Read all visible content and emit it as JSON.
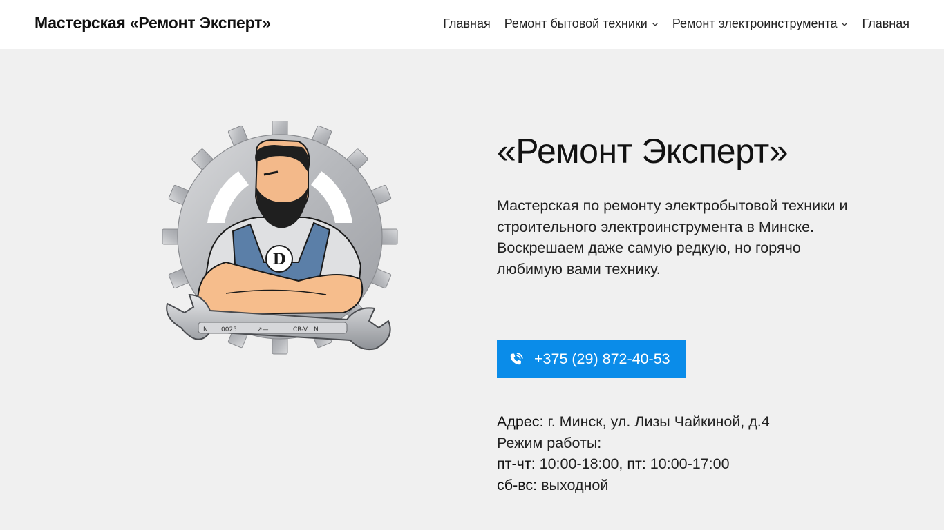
{
  "header": {
    "site_title": "Мастерская «Ремонт Эксперт»",
    "nav": [
      {
        "label": "Главная"
      },
      {
        "label": "Ремонт бытовой техники",
        "dropdown": true
      },
      {
        "label": "Ремонт электроинструмента",
        "dropdown": true
      },
      {
        "label": "Главная"
      }
    ]
  },
  "hero": {
    "title": "«Ремонт Эксперт»",
    "description": "Мастерская по ремонту электробытовой техники и строительного электроинструмента в Минске. Воскрешаем даже самую редкую, но горячо любимую вами технику.",
    "phone": "+375 (29) 872-40-53",
    "phone_icon": "phone-call-icon"
  },
  "info": {
    "address_label": "Адрес:",
    "address_value": " г. Минск, ул. Лизы Чайкиной, д.4",
    "hours_label": "Режим работы:",
    "weekdays_label": "пт-чт:",
    "weekdays_value": " 10:00-18:00, ",
    "friday_label": "пт:",
    "friday_value": " 10:00-17:00",
    "weekend_label": "сб-вс:",
    "weekend_value": " выходной"
  },
  "illustration": {
    "badge_letter": "D",
    "wrench_marks": [
      "N",
      "0025",
      "↗—",
      "CR-V",
      "N"
    ]
  },
  "colors": {
    "accent": "#0a8ce9",
    "background": "#f0f0f0",
    "header_bg": "#ffffff"
  }
}
